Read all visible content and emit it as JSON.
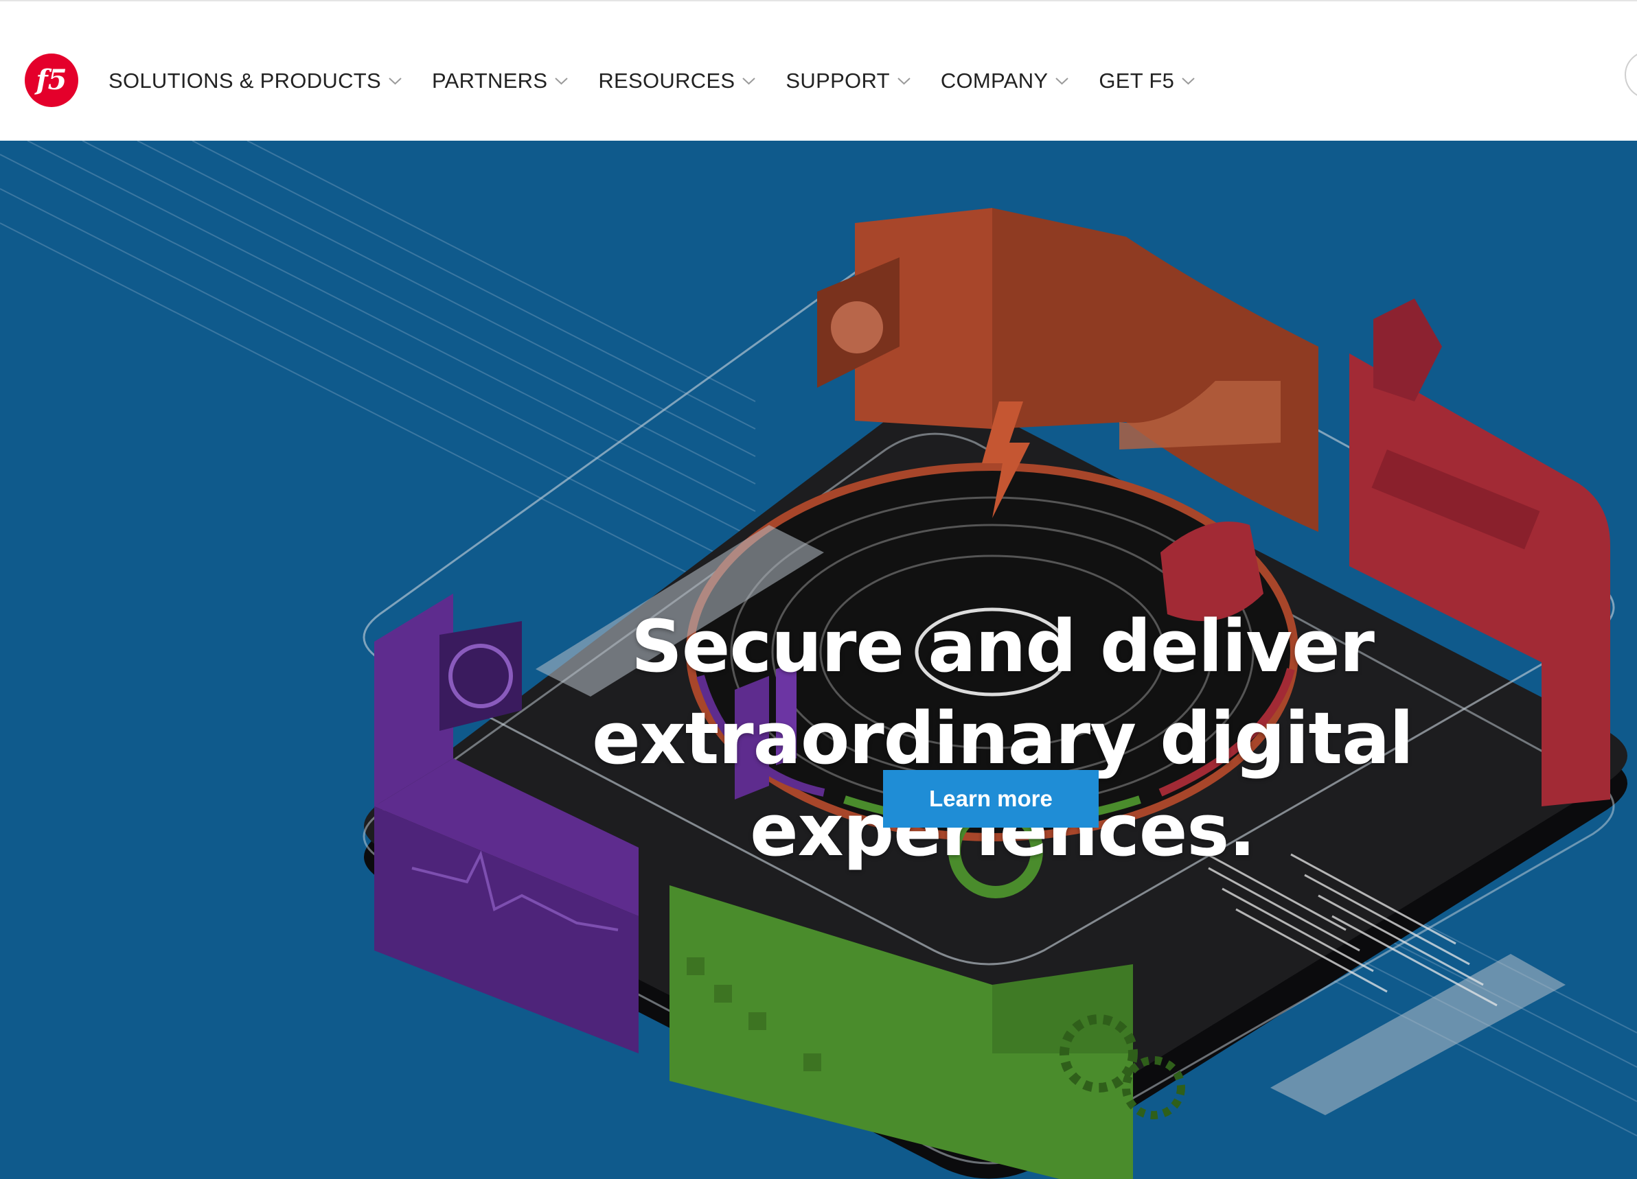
{
  "brand": {
    "logo_text": "f5",
    "logo_color": "#e4002b"
  },
  "nav": {
    "items": [
      {
        "label": "SOLUTIONS & PRODUCTS"
      },
      {
        "label": "PARTNERS"
      },
      {
        "label": "RESOURCES"
      },
      {
        "label": "SUPPORT"
      },
      {
        "label": "COMPANY"
      },
      {
        "label": "GET F5"
      }
    ],
    "chevron_icon": "chevron-down-icon"
  },
  "hero": {
    "headline_line1": "Secure and deliver extraordinary digital",
    "headline_line2": "experiences.",
    "cta_label": "Learn more",
    "background_color": "#0f5a8c",
    "cta_color": "#1f8dd6",
    "panel_colors": {
      "orange": "#b24a2a",
      "red": "#a22a35",
      "purple": "#5e2c8e",
      "green": "#4a8c2c",
      "platform": "#1d1d1f"
    }
  }
}
